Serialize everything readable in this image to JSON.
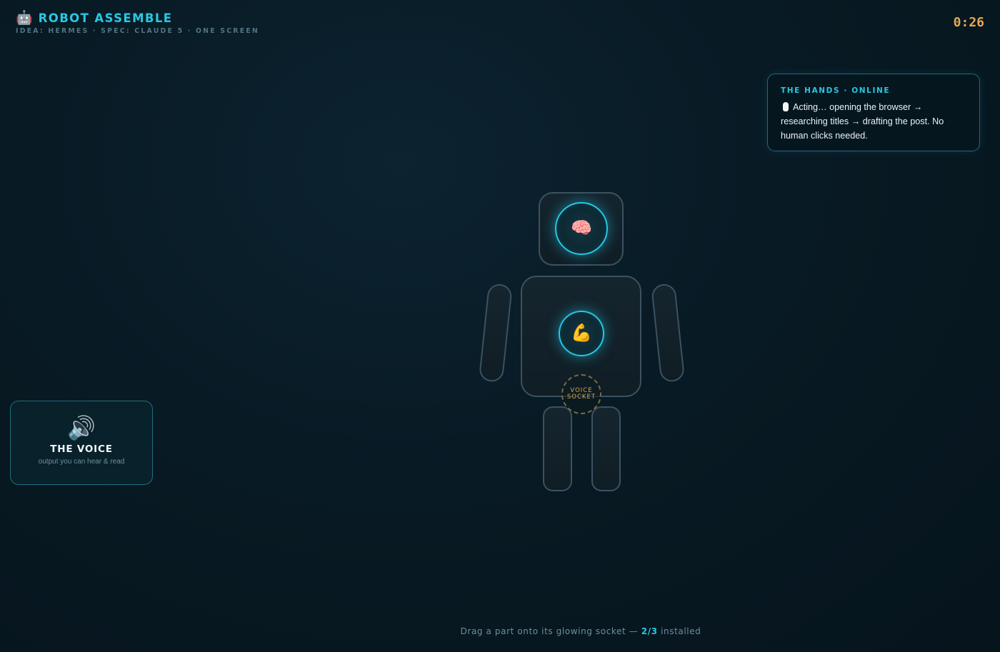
{
  "header": {
    "icon": "robot-icon",
    "title": "ROBOT ASSEMBLE",
    "subtitle": "IDEA: HERMES · SPEC: CLAUDE 5 · ONE SCREEN",
    "timer": "0:26"
  },
  "status_card": {
    "heading": "THE HANDS · ONLINE",
    "icon": "mouse-icon",
    "body": "Acting… opening the browser → researching titles → drafting the post. No human clicks needed."
  },
  "part_card": {
    "icon": "speaker-icon",
    "icon_glyph": "🔊",
    "name": "THE VOICE",
    "description": "output you can hear & read"
  },
  "robot": {
    "sockets": [
      {
        "part": "brain",
        "state": "installed",
        "icon": "brain-icon",
        "glyph": "🧠"
      },
      {
        "part": "hands",
        "state": "installed",
        "icon": "flexed-arm-icon",
        "glyph": "💪"
      },
      {
        "part": "voice",
        "state": "empty",
        "label": "VOICE\nSOCKET"
      }
    ]
  },
  "footer": {
    "instruction": "Drag a part onto its glowing socket —",
    "progress": "2/3",
    "suffix": "installed"
  },
  "colors": {
    "accent": "#27c8e2",
    "timer": "#e6a756",
    "socket_empty": "#d7a64e",
    "background": "#081a24"
  }
}
